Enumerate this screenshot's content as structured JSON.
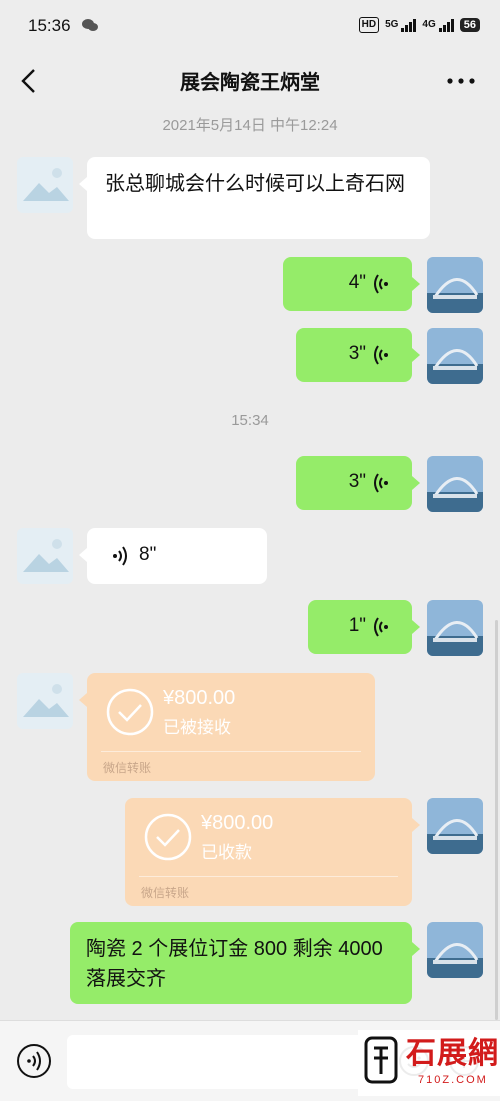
{
  "status": {
    "time": "15:36",
    "hd": "HD",
    "net1": "5G",
    "net2": "4G",
    "battery": "56"
  },
  "header": {
    "title": "展会陶瓷王炳堂"
  },
  "timestamps": {
    "first": "2021年5月14日 中午12:24",
    "second": "15:34"
  },
  "messages": {
    "m1": {
      "side": "left",
      "type": "text",
      "text": "张总聊城会什么时候可以上奇石网"
    },
    "m2": {
      "side": "right",
      "type": "voice",
      "duration": "4\""
    },
    "m3": {
      "side": "right",
      "type": "voice",
      "duration": "3\""
    },
    "m4": {
      "side": "right",
      "type": "voice",
      "duration": "3\""
    },
    "m5": {
      "side": "left",
      "type": "voice",
      "duration": "8\""
    },
    "m6": {
      "side": "right",
      "type": "voice",
      "duration": "1\""
    },
    "m7": {
      "side": "left",
      "type": "transfer",
      "amount": "¥800.00",
      "status": "已被接收",
      "footer": "微信转账"
    },
    "m8": {
      "side": "right",
      "type": "transfer",
      "amount": "¥800.00",
      "status": "已收款",
      "footer": "微信转账"
    },
    "m9": {
      "side": "right",
      "type": "text",
      "text": "陶瓷 2 个展位订金 800 剩余 4000 落展交齐"
    }
  },
  "left_avatar_placeholder": "图片无法显示",
  "watermark": {
    "main": "石展網",
    "sub": "710Z.COM"
  },
  "colors": {
    "bg": "#ececec",
    "green_bubble": "#95ec69",
    "transfer": "#fbd9b6"
  },
  "icons": [
    "back-arrow-icon",
    "more-icon",
    "voice-wave-icon",
    "check-circle-icon",
    "voice-input-icon",
    "emoji-icon",
    "plus-icon"
  ]
}
